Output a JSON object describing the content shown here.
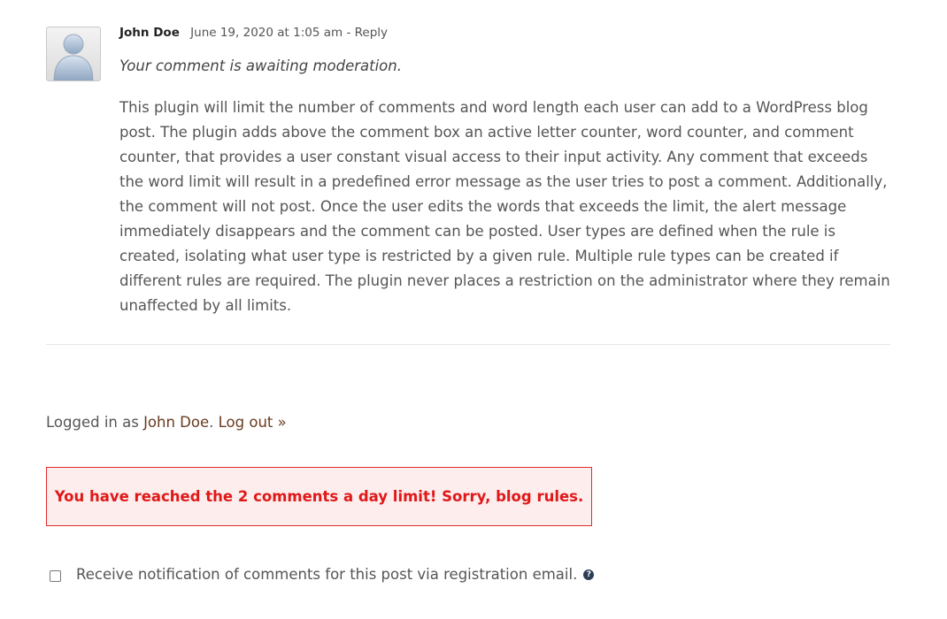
{
  "comment": {
    "author": "John Doe",
    "date": "June 19, 2020 at 1:05 am",
    "separator": " - ",
    "reply_label": "Reply",
    "moderation_notice": "Your comment is awaiting moderation.",
    "text": "This plugin will limit the number of comments and word length each user can add to a WordPress blog post. The plugin adds above the comment box an active letter counter, word counter, and comment counter, that provides a user constant visual access to their input activity. Any comment that exceeds the word limit will result in a predefined error message as the user tries to post a comment. Additionally, the comment will not post. Once the user edits the words that exceeds the limit, the alert message immediately disappears and the comment can be posted. User types are defined when the rule is created, isolating what user type is restricted by a given rule. Multiple rule types can be created if different rules are required. The plugin never places a restriction on the administrator where they remain unaffected by all limits."
  },
  "login": {
    "prefix": "Logged in as ",
    "user": "John Doe",
    "period": ". ",
    "logout_label": "Log out »"
  },
  "alert": {
    "message": "You have reached the 2 comments a day limit! Sorry, blog rules."
  },
  "notify": {
    "label": "Receive notification of comments for this post via registration email.",
    "checked": false,
    "help_icon": "?"
  },
  "colors": {
    "alert_text": "#e01818",
    "alert_border": "#e32c2c",
    "alert_bg": "#fdeded",
    "link": "#6b3b1f"
  },
  "icons": {
    "avatar": "default-user-avatar-icon",
    "help": "question-circle-icon"
  }
}
